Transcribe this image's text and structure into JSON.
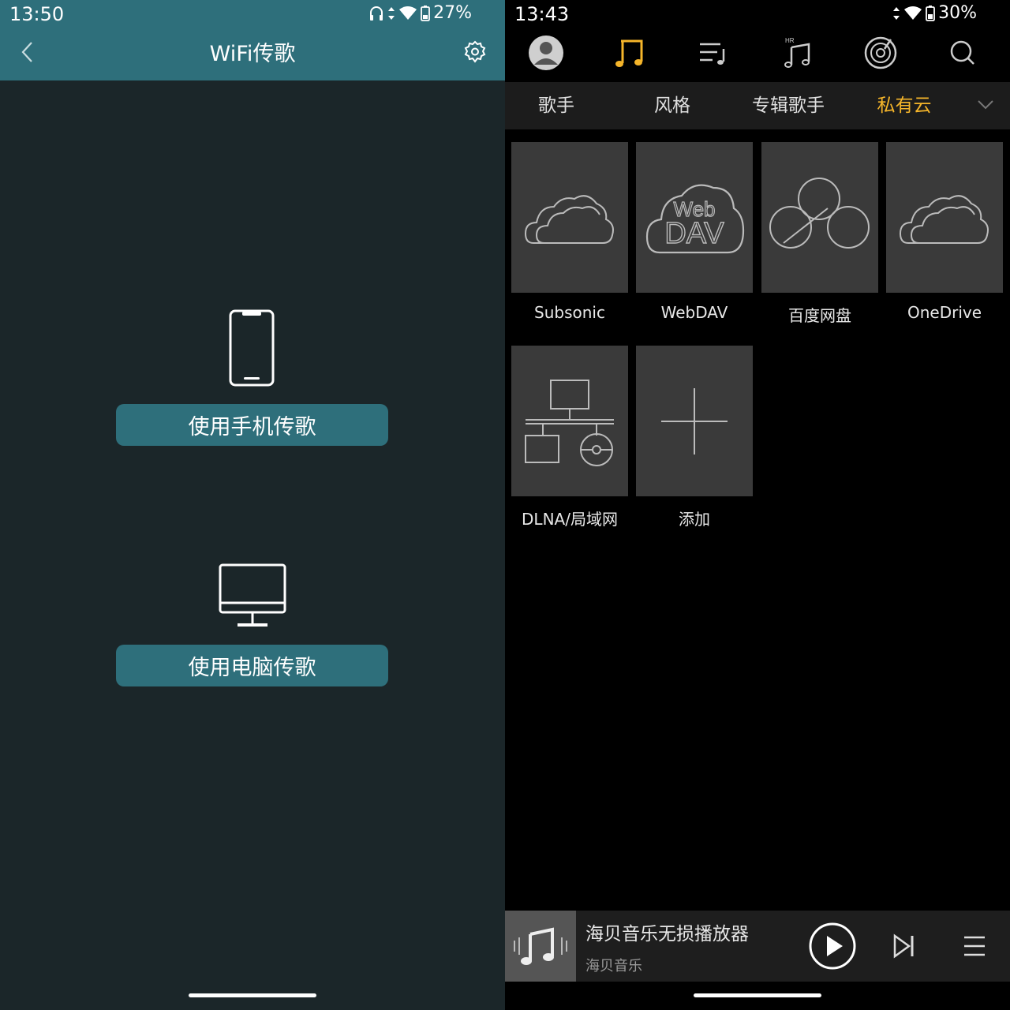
{
  "left": {
    "status": {
      "time": "13:50",
      "battery": "27%"
    },
    "header": {
      "title": "WiFi传歌"
    },
    "phone_button_label": "使用手机传歌",
    "pc_button_label": "使用电脑传歌"
  },
  "right": {
    "status": {
      "time": "13:43",
      "battery": "30%"
    },
    "tabs": [
      "歌手",
      "风格",
      "专辑歌手",
      "私有云"
    ],
    "active_tab": "私有云",
    "tiles": [
      "Subsonic",
      "WebDAV",
      "百度网盘",
      "OneDrive",
      "DLNA/局域网",
      "添加"
    ],
    "webdav_logo": {
      "line1": "Web",
      "line2": "DAV"
    },
    "nav_hr_badge": "HR",
    "player": {
      "title": "海贝音乐无损播放器",
      "artist": "海贝音乐"
    }
  },
  "colors": {
    "left_bg": "#1b2629",
    "left_accent": "#2e6f7b",
    "right_active": "#f5b52a",
    "tile_bg": "#3a3a3a"
  },
  "icons": {
    "left": [
      "back-icon",
      "gear-icon",
      "smartphone-icon",
      "monitor-icon"
    ],
    "right_nav": [
      "avatar-icon",
      "music-note-icon",
      "playlist-icon",
      "hr-music-icon",
      "vinyl-icon",
      "search-icon"
    ]
  }
}
